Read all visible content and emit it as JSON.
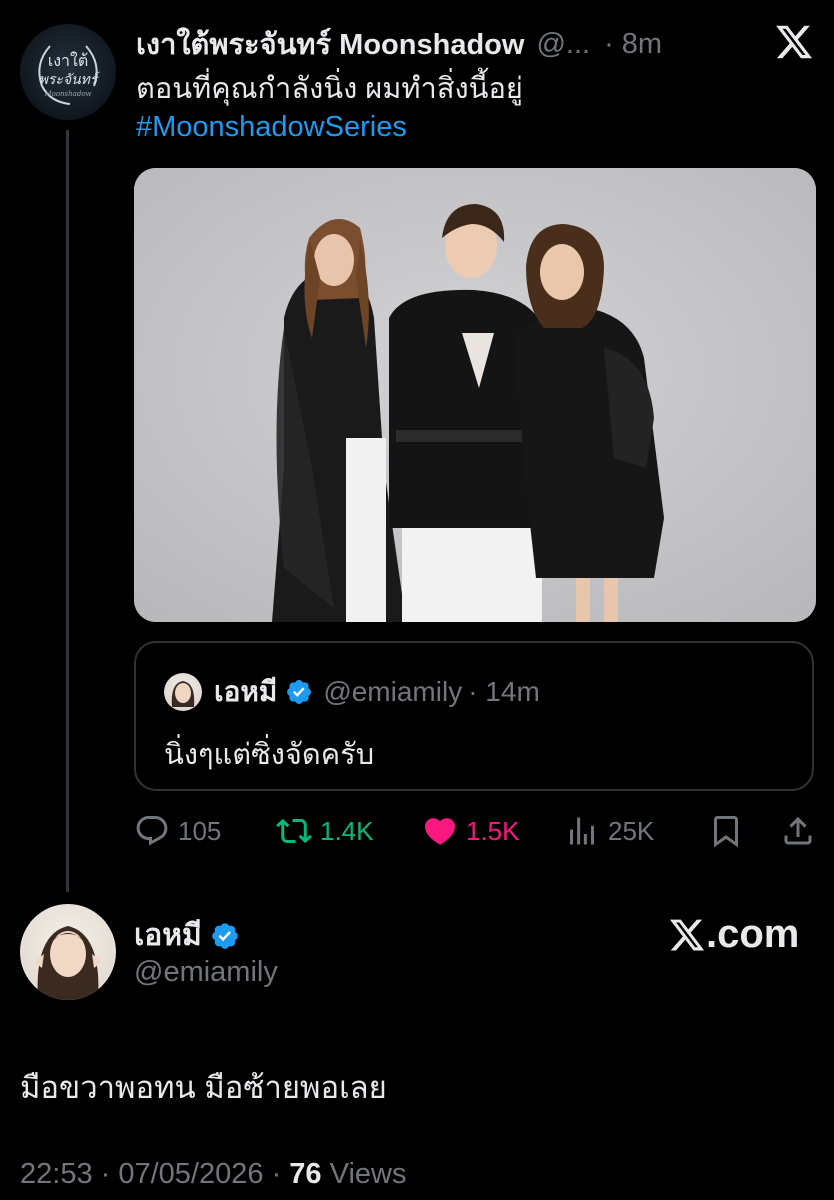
{
  "parent_tweet": {
    "author_name": "เงาใต้พระจันทร์ Moonshadow",
    "handle": "@...",
    "time": "· 8m",
    "text": "ตอนที่คุณกำลังนิ่ง ผมทำสิ่งนี้อยู่",
    "hashtag": "#MoonshadowSeries",
    "avatar_logo_line1": "เงาใต้",
    "avatar_logo_line2": "พระจันทร์",
    "avatar_logo_line3": "Moonshadow"
  },
  "quoted_tweet": {
    "author_name": "เอหมี",
    "handle": "@emiamily",
    "time": "· 14m",
    "text": "นิ่งๆแต่ซิ่งจัดครับ"
  },
  "actions": {
    "replies": "105",
    "reposts": "1.4K",
    "likes": "1.5K",
    "views": "25K"
  },
  "main_tweet": {
    "author_name": "เอหมี",
    "handle": "@emiamily",
    "text": "มือขวาพอทน มือซ้ายพอเลย",
    "time": "22:53",
    "date": "07/05/2026",
    "views_count": "76",
    "views_label": "Views"
  },
  "watermark": {
    "text": ".com"
  },
  "colors": {
    "background": "#000000",
    "accent_blue": "#1d9bf0",
    "repost_green": "#00ba7c",
    "like_pink": "#f91880",
    "muted": "#71767b"
  }
}
